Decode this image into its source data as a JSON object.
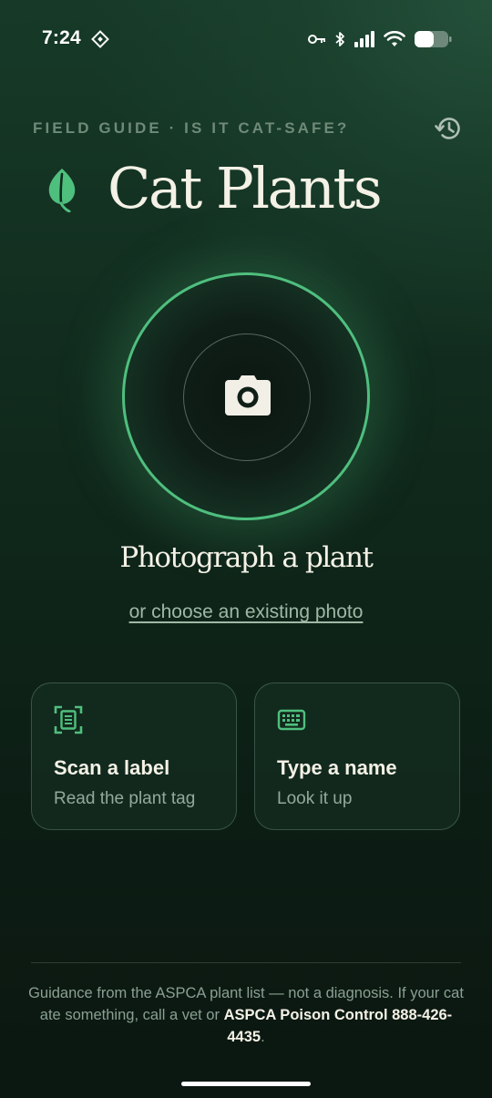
{
  "status_bar": {
    "time": "7:24",
    "icons": [
      "location-diamond-icon",
      "key-icon",
      "bluetooth-icon",
      "cellular-signal-icon",
      "wifi-icon",
      "battery-icon"
    ],
    "battery_level": 0.55
  },
  "header": {
    "eyebrow": "FIELD GUIDE · IS IT CAT-SAFE?",
    "title": "Cat Plants",
    "history_icon": "history-icon",
    "logo_icon": "leaf-icon"
  },
  "capture": {
    "icon": "camera-icon",
    "label": "Photograph a plant",
    "alt_link": "or choose an existing photo"
  },
  "options": [
    {
      "icon": "scan-document-icon",
      "title": "Scan a label",
      "subtitle": "Read the plant tag"
    },
    {
      "icon": "keyboard-icon",
      "title": "Type a name",
      "subtitle": "Look it up"
    }
  ],
  "footer": {
    "text_before": "Guidance from the ASPCA plant list — not a diagnosis. If your cat ate something, call a vet or ",
    "emphasis": "ASPCA Poison Control 888-426-4435",
    "text_after": "."
  },
  "colors": {
    "accent": "#4fbf7e",
    "background_dark": "#0c1d14",
    "background_green": "#24503a",
    "text_primary": "#f4f1e6",
    "text_muted": "#8aa091"
  }
}
